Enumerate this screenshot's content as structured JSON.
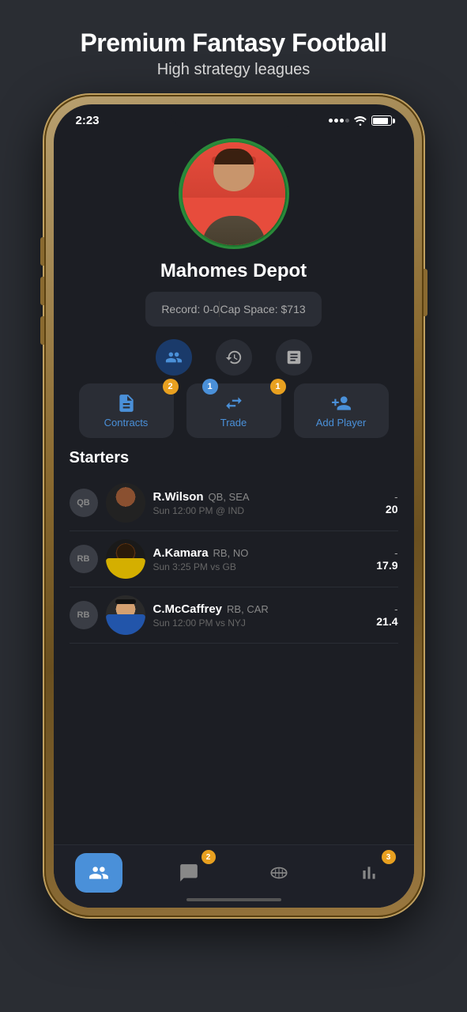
{
  "header": {
    "title": "Premium Fantasy Football",
    "subtitle": "High strategy leagues"
  },
  "status_bar": {
    "time": "2:23",
    "battery": "100"
  },
  "team": {
    "name": "Mahomes Depot",
    "record_label": "Record: 0-0",
    "cap_label": "Cap Space: $713"
  },
  "action_buttons": {
    "contracts_label": "Contracts",
    "contracts_badge": "2",
    "trade_label": "Trade",
    "trade_badge_blue": "1",
    "trade_badge_orange": "1",
    "add_player_label": "Add Player"
  },
  "starters": {
    "title": "Starters",
    "players": [
      {
        "position": "QB",
        "name": "R.Wilson",
        "pos_team": "QB, SEA",
        "game": "Sun 12:00 PM @ IND",
        "score": "20"
      },
      {
        "position": "RB",
        "name": "A.Kamara",
        "pos_team": "RB, NO",
        "game": "Sun 3:25 PM vs GB",
        "score": "17.9"
      },
      {
        "position": "RB",
        "name": "C.McCaffrey",
        "pos_team": "RB, CAR",
        "game": "Sun 12:00 PM vs NYJ",
        "score": "21.4"
      }
    ]
  },
  "tab_bar": {
    "tabs": [
      {
        "name": "team",
        "badge": null,
        "active": true
      },
      {
        "name": "chat",
        "badge": "2",
        "active": false
      },
      {
        "name": "football",
        "badge": null,
        "active": false
      },
      {
        "name": "standings",
        "badge": "3",
        "active": false
      }
    ]
  }
}
